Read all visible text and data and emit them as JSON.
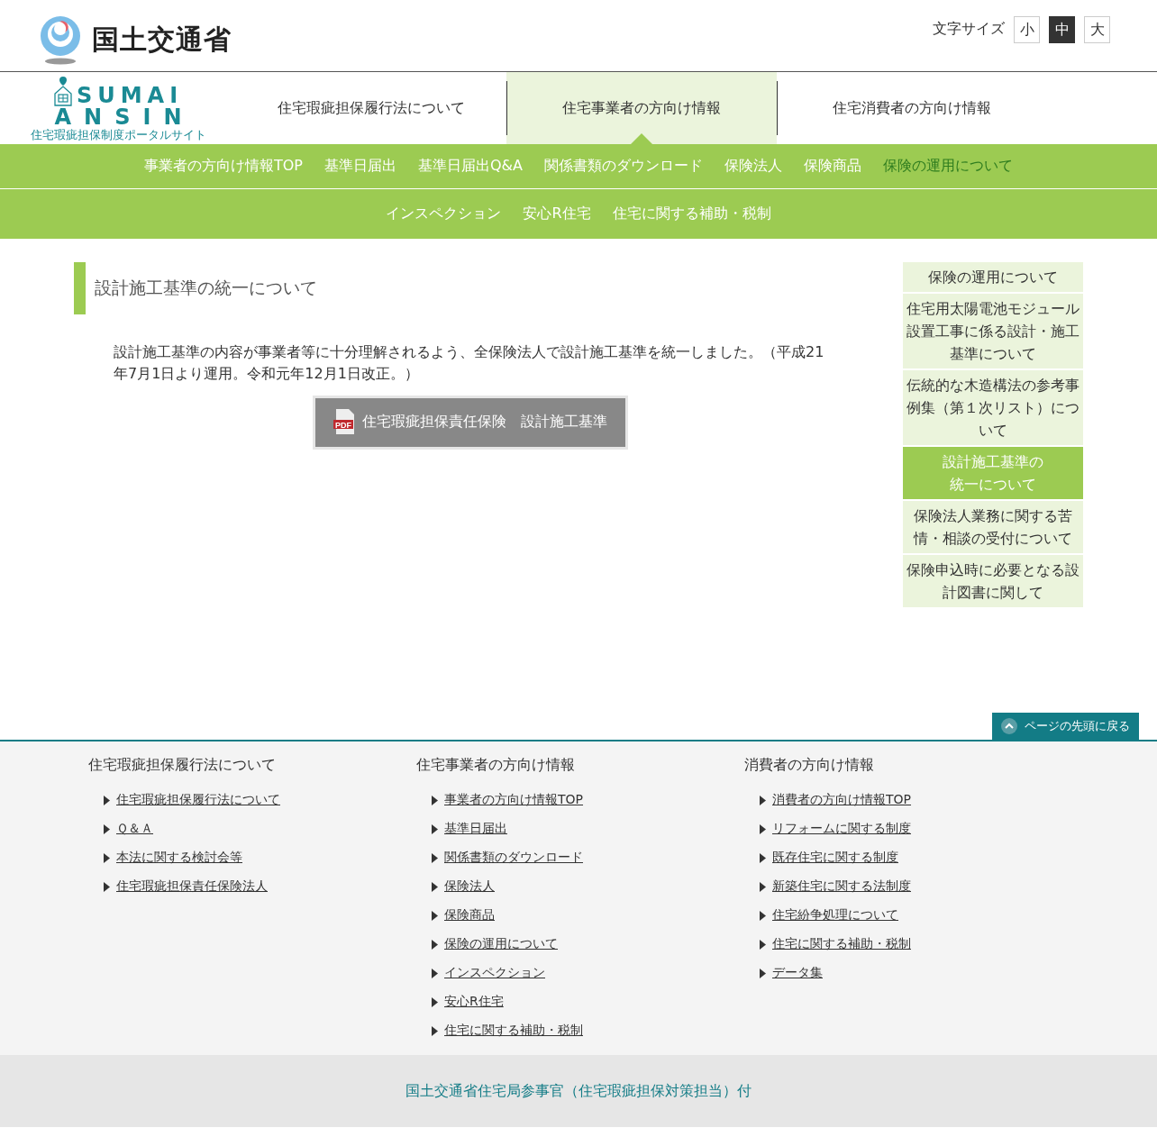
{
  "header": {
    "ministry_name": "国土交通省",
    "font_size": {
      "label": "文字サイズ",
      "options": [
        {
          "label": "小",
          "selected": false
        },
        {
          "label": "中",
          "selected": true
        },
        {
          "label": "大",
          "selected": false
        }
      ]
    }
  },
  "site_logo": {
    "line_1": "SUMAI",
    "line_2": "ANSIN",
    "subtitle": "住宅瑕疵担保制度ポータルサイト"
  },
  "main_tabs": [
    {
      "label": "住宅瑕疵担保履行法について",
      "selected": false
    },
    {
      "label": "住宅事業者の方向け情報",
      "selected": true
    },
    {
      "label": "住宅消費者の方向け情報",
      "selected": false
    }
  ],
  "sub_nav": [
    [
      {
        "label": "事業者の方向け情報TOP",
        "selected": false
      },
      {
        "label": "基準日届出",
        "selected": false
      },
      {
        "label": "基準日届出Q&A",
        "selected": false
      },
      {
        "label": "関係書類のダウンロード",
        "selected": false
      },
      {
        "label": "保険法人",
        "selected": false
      },
      {
        "label": "保険商品",
        "selected": false
      },
      {
        "label": "保険の運用について",
        "selected": true
      }
    ],
    [
      {
        "label": "インスペクション",
        "selected": false
      },
      {
        "label": "安心R住宅",
        "selected": false
      },
      {
        "label": "住宅に関する補助・税制",
        "selected": false
      }
    ]
  ],
  "page_title": "設計施工基準の統一について",
  "body_text": "設計施工基準の内容が事業者等に十分理解されるよう、全保険法人で設計施工基準を統一しました。（平成21年7月1日より運用。令和元年12月1日改正。）",
  "pdf_button": {
    "icon_label": "PDF",
    "label": "住宅瑕疵担保責任保険　設計施工基準"
  },
  "sidebar": [
    {
      "label": "保険の運用について",
      "selected": false
    },
    {
      "label": "住宅用太陽電池モジュール設置工事に係る設計・施工基準について",
      "selected": false
    },
    {
      "label": "伝統的な木造構法の参考事例集（第１次リスト）について",
      "selected": false
    },
    {
      "label": "設計施工基準の統一について",
      "selected": true
    },
    {
      "label": "保険法人業務に関する苦情・相談の受付について",
      "selected": false
    },
    {
      "label": "保険申込時に必要となる設計図書に関して",
      "selected": false
    }
  ],
  "back_to_top": "ページの先頭に戻る",
  "footer_columns": [
    {
      "heading": "住宅瑕疵担保履行法について",
      "links": [
        "住宅瑕疵担保履行法について",
        "Ｑ＆Ａ",
        "本法に関する検討会等",
        "住宅瑕疵担保責任保険法人"
      ]
    },
    {
      "heading": "住宅事業者の方向け情報",
      "links": [
        "事業者の方向け情報TOP",
        "基準日届出",
        "関係書類のダウンロード",
        "保険法人",
        "保険商品",
        "保険の運用について",
        "インスペクション",
        "安心R住宅",
        "住宅に関する補助・税制"
      ]
    },
    {
      "heading": "消費者の方向け情報",
      "links": [
        "消費者の方向け情報TOP",
        "リフォームに関する制度",
        "既存住宅に関する制度",
        "新築住宅に関する法制度",
        "住宅紛争処理について",
        "住宅に関する補助・税制",
        "データ集"
      ]
    }
  ],
  "footer_credit": "国土交通省住宅局参事官（住宅瑕疵担保対策担当）付"
}
